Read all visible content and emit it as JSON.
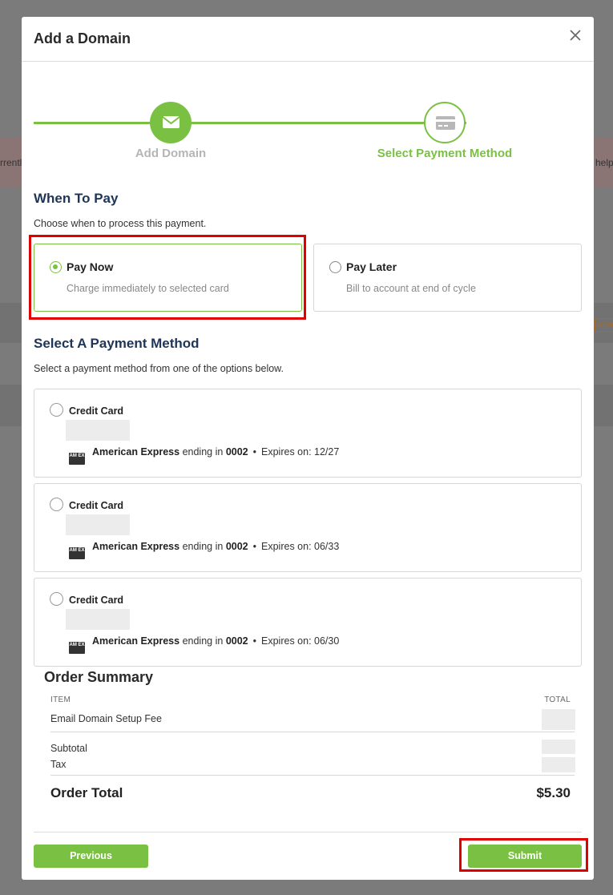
{
  "background": {
    "left_fragment": "rrentl",
    "right_fragment": "help",
    "right_tag": "mpo"
  },
  "modal": {
    "title": "Add a Domain"
  },
  "stepper": {
    "steps": [
      {
        "label": "Add Domain",
        "icon": "envelope-icon",
        "state": "complete"
      },
      {
        "label": "Select Payment Method",
        "icon": "credit-card-icon",
        "state": "active"
      }
    ]
  },
  "when_to_pay": {
    "title": "When To Pay",
    "subtitle": "Choose when to process this payment.",
    "options": [
      {
        "label": "Pay Now",
        "description": "Charge immediately to selected card",
        "selected": true
      },
      {
        "label": "Pay Later",
        "description": "Bill to account at end of cycle",
        "selected": false
      }
    ]
  },
  "payment_method": {
    "title": "Select A Payment Method",
    "subtitle": "Select a payment method from one of the options below.",
    "cards": [
      {
        "type_label": "Credit Card",
        "brand": "American Express",
        "ending_text": "ending in",
        "last4": "0002",
        "expires_label": "Expires on:",
        "expiry": "12/27"
      },
      {
        "type_label": "Credit Card",
        "brand": "American Express",
        "ending_text": "ending in",
        "last4": "0002",
        "expires_label": "Expires on:",
        "expiry": "06/33"
      },
      {
        "type_label": "Credit Card",
        "brand": "American Express",
        "ending_text": "ending in",
        "last4": "0002",
        "expires_label": "Expires on:",
        "expiry": "06/30"
      }
    ],
    "dot": "•",
    "amex_icon_text": "AM EX"
  },
  "order_summary": {
    "title": "Order Summary",
    "item_header": "ITEM",
    "total_header": "TOTAL",
    "line_item": "Email Domain Setup Fee",
    "subtotal_label": "Subtotal",
    "tax_label": "Tax",
    "order_total_label": "Order Total",
    "order_total_value": "$5.30"
  },
  "footer": {
    "previous_label": "Previous",
    "submit_label": "Submit"
  },
  "colors": {
    "accent": "#7ac143",
    "heading": "#1d3557",
    "highlight": "#e00000"
  }
}
